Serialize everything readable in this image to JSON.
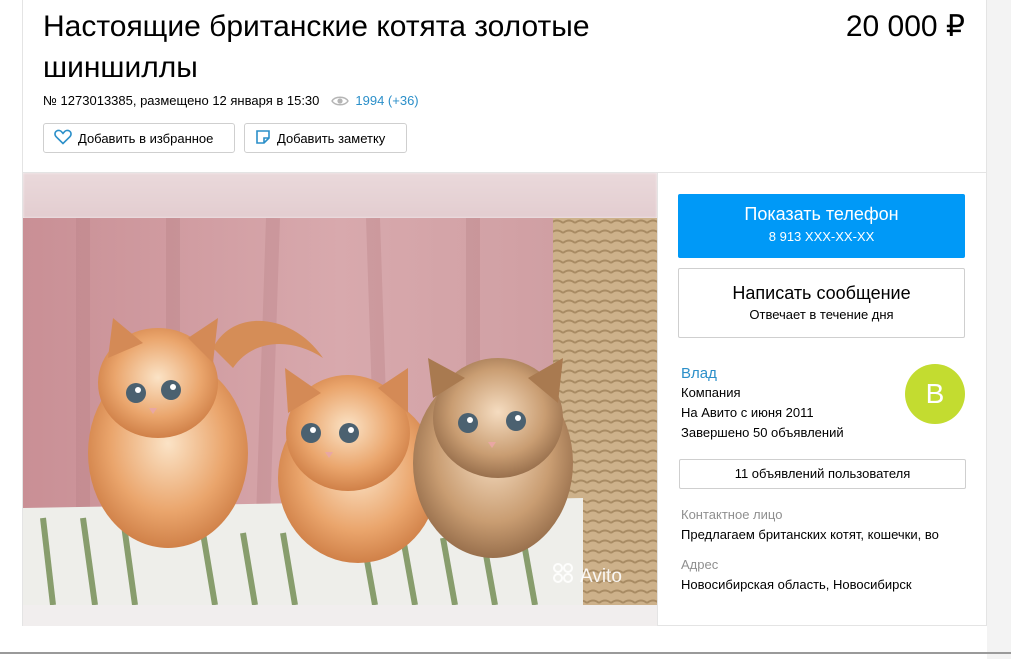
{
  "listing": {
    "title": "Настоящие британские котята золотые шиншиллы",
    "price": "20 000 ₽",
    "meta": "№ 1273013385, размещено 12 января в 15:30",
    "views": "1994 (+36)",
    "favorite_label": "Добавить в избранное",
    "note_label": "Добавить заметку"
  },
  "photo": {
    "watermark": "Avito"
  },
  "contact": {
    "phone_title": "Показать телефон",
    "phone_number": "8 913 XXX-XX-XX",
    "message_title": "Написать сообщение",
    "message_sub": "Отвечает в течение дня"
  },
  "seller": {
    "name": "Влад",
    "type": "Компания",
    "since": "На Авито с июня 2011",
    "completed": "Завершено 50 объявлений",
    "avatar_letter": "В",
    "avatar_color": "#c3dc30",
    "listings_button": "11 объявлений пользователя"
  },
  "details": {
    "contact_label": "Контактное лицо",
    "contact_value": "Предлагаем британских котят, кошечки, во",
    "address_label": "Адрес",
    "address_value": "Новосибирская область, Новосибирск"
  },
  "colors": {
    "accent": "#0099f7",
    "link": "#2b8fc9"
  },
  "icons": [
    "heart-icon",
    "note-icon",
    "eye-icon",
    "avito-logo-icon"
  ]
}
